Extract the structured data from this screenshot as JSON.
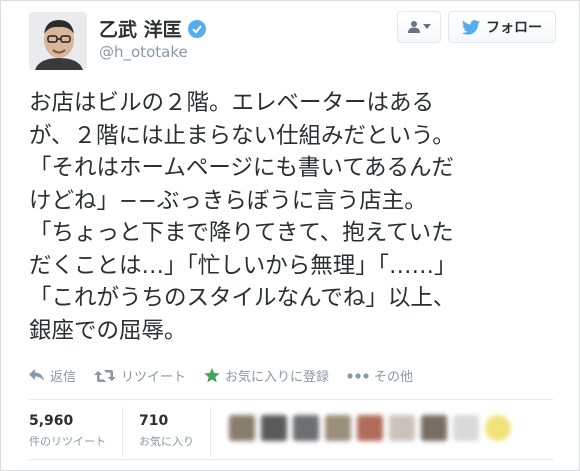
{
  "user": {
    "name": "乙武 洋匡",
    "handle": "@h_ototake"
  },
  "follow_button": {
    "label": "フォロー"
  },
  "tweet": {
    "lines": [
      "お店はビルの２階。エレベーターはある",
      "が、２階には止まらない仕組みだという。",
      "「それはホームページにも書いてあるんだ",
      "けどね」−−ぶっきらぼうに言う店主。",
      "「ちょっと下まで降りてきて、抱えていた",
      "だくことは…」「忙しいから無理」「……」",
      "「これがうちのスタイルなんでね」以上、",
      "銀座での屈辱。"
    ]
  },
  "actions": {
    "reply": "返信",
    "retweet": "リツイート",
    "favorite": "お気に入りに登録",
    "more": "その他"
  },
  "stats": {
    "retweets": {
      "count": "5,960",
      "label": "件のリツイート"
    },
    "favorites": {
      "count": "710",
      "label": "お気に入り"
    }
  },
  "colors": {
    "accent": "#55acee",
    "text": "#292f33",
    "muted": "#8899a6",
    "favorite_star": "#44a55a"
  },
  "icons": {
    "reply": "reply-arrow-icon",
    "retweet": "retweet-icon",
    "favorite": "star-icon",
    "more": "ellipsis-icon",
    "bird": "twitter-bird-icon",
    "user": "user-icon",
    "verified": "verified-badge-icon"
  }
}
